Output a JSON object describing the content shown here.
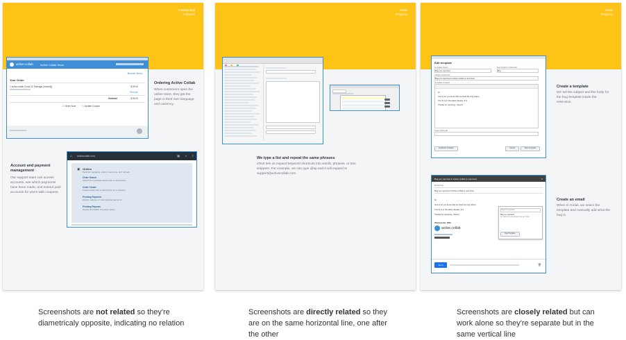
{
  "cards": [
    {
      "brand": "FastSprings",
      "brand_sub": "Snippets",
      "shot1": {
        "app_name": "active.collab",
        "header_link": "Active Collab Store",
        "section_title": "Your Order",
        "action_link": "Browse Items",
        "order_line": "1 active.collab Cloud 12 Package (monthly)",
        "price": "$ 99.00",
        "remove": "Remove",
        "subtotal_label": "Subtotal",
        "subtotal": "$ 99.00",
        "order_now": "Order Now",
        "update_coupon": "Update Coupon"
      },
      "desc1_title": "Ordering Active Collab",
      "desc1_body": "When customers open the online store, they get the page in their own language and currency.",
      "desc2_title": "Account and payment management",
      "desc2_body": "Our support team can access accounts, see which payments have been made, and extend paid accounts for users with coupons.",
      "shot2": {
        "title": "activecollab.com",
        "section": "Orders",
        "section_sub": "Tools for managing orders, customers, and refunds.",
        "items": [
          {
            "title": "Order Search",
            "sub": "Search for a purchase based order or subscription."
          },
          {
            "title": "Order Create",
            "sub": "Create a paid order or paid invoice for a customer."
          },
          {
            "title": "Pending Payment",
            "sub": "Review, approve, or reject pending payments."
          },
          {
            "title": "Pending Payouts",
            "sub": "Review and finalize the payout queue."
          }
        ]
      },
      "caption_pre": "Screenshots are ",
      "caption_bold": "not related",
      "caption_post": " so they're diametricaly opposite, indicating no relation"
    },
    {
      "brand": "aText",
      "brand_sub": "Snippets",
      "desc_title": "We type a list and repeat the same phrases",
      "desc_body": "aText lets us expand keyword shortcuts into words, phrases, or text snippets. For example, we can type @sp and it will expand to support@activecollab.com.",
      "caption_pre": "Screenshots are ",
      "caption_bold": "directly related",
      "caption_post": " so they are on the same horizontal line, one after the other"
    },
    {
      "brand": "aText",
      "brand_sub": "Snippets",
      "shot1": {
        "title": "Edit template",
        "name_label": "Template Name",
        "name_value": "Bug you reported",
        "shortcut_label": "Text shortcut (Optional)",
        "shortcut_value": "#bg",
        "subject_label": "Subject (Optional)",
        "subject_value": "Bug you reported in Active Collab is now fixed",
        "content_label": "Template Content",
        "body1": "Hi,",
        "body2": "Just to let you know that we fixed the bug where:",
        "body3": "The fix is in the latest release, 5.0.",
        "body4": "Thanks for reporting, cheers!",
        "tags_label": "Tags (Optional)",
        "duplicate": "Duplicate template",
        "cancel": "Cancel",
        "save": "Save template"
      },
      "desc1_title": "Create a template",
      "desc1_body": "We set the subject and the body for the bug template inside the extension.",
      "shot2": {
        "subject": "Bug you reported in Active Collab is now fixed",
        "recipients": "Recipients",
        "subject_line": "Bug you reported in Active Collab is now fixed",
        "hi": "Hi,",
        "body1": "Just to let you know that we fixed the bug where:",
        "body2": "The fix is in the latest release, 5.0.",
        "body3": "Thanks for reporting, cheers!",
        "signature": "Weeksender: DNA",
        "logo": "active.collab",
        "send": "Send",
        "search": "Search templates",
        "popup_item": "Bug you reported",
        "popup_sub": "Hi, just to let you know that we fixed...",
        "new_template": "New Template"
      },
      "desc2_title": "Create an email",
      "desc2_body": "When in Gmail, we select the template and manually add what the bug is.",
      "caption_pre": "Screenshots are ",
      "caption_bold": "closely related",
      "caption_post": " but can work alone so they're separate but in the same vertical line"
    }
  ],
  "colors": {
    "accent": "#fec317",
    "highlight": "#3a8fd9",
    "card": "#f4f5f7"
  }
}
